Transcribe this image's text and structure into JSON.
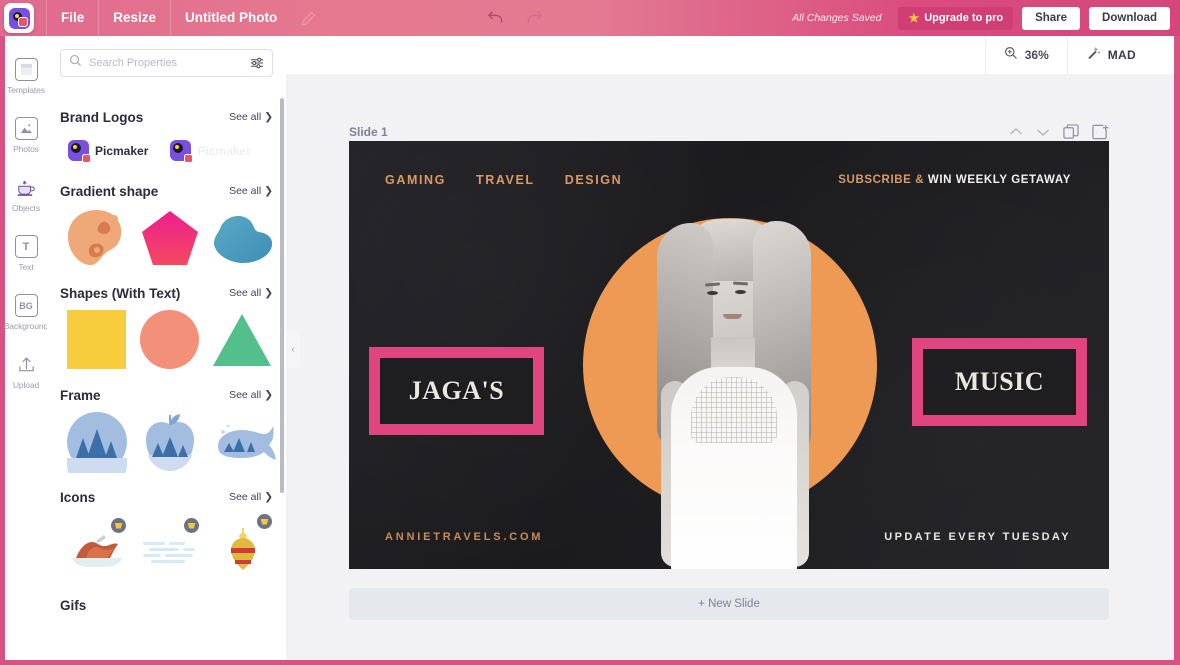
{
  "topbar": {
    "logo_icon": "picmaker-logo-icon",
    "menu": [
      {
        "label": "File"
      },
      {
        "label": "Resize"
      }
    ],
    "doc_title": "Untitled Photo",
    "edit_icon": "pencil-icon",
    "undo_icon": "undo-arrow-icon",
    "redo_icon": "redo-arrow-icon",
    "saved_status": "All Changes Saved",
    "upgrade_label": "Upgrade to pro",
    "upgrade_star": "★",
    "share_label": "Share",
    "download_label": "Download",
    "accent_pink": "#d4477c",
    "upgrade_bg": "#cf3f73"
  },
  "rail": {
    "items": [
      {
        "label": "Templates",
        "icon": "templates-icon",
        "glyph": "▤"
      },
      {
        "label": "Photos",
        "icon": "photos-image-icon",
        "glyph": "▣"
      },
      {
        "label": "Objects",
        "icon": "objects-cup-icon",
        "glyph": "☕"
      },
      {
        "label": "Text",
        "icon": "text-icon",
        "glyph": "T"
      },
      {
        "label": "Background",
        "icon": "background-icon",
        "glyph": "BG"
      },
      {
        "label": "Upload",
        "icon": "upload-arrow-icon",
        "glyph": "⭱"
      }
    ]
  },
  "panel": {
    "search": {
      "placeholder": "Search Properties",
      "value": "",
      "search_icon": "search-icon",
      "filter_icon": "filter-sliders-icon"
    },
    "see_all_label": "See all",
    "chevron": "❯",
    "collapse_icon": "chevron-left-icon",
    "sections": [
      {
        "title": "Brand Logos",
        "items": [
          {
            "name": "Picmaker",
            "faded": false
          },
          {
            "name": "Picmaker",
            "faded": true
          }
        ]
      },
      {
        "title": "Gradient shape",
        "items": [
          {
            "name": "blob-orange-shape"
          },
          {
            "name": "pentagon-pink-shape"
          },
          {
            "name": "blob-blue-shape"
          }
        ]
      },
      {
        "title": "Shapes (With Text)",
        "items": [
          {
            "name": "square-yellow-shape"
          },
          {
            "name": "circle-coral-shape"
          },
          {
            "name": "triangle-green-shape"
          }
        ]
      },
      {
        "title": "Frame",
        "items": [
          {
            "name": "circle-forest-frame"
          },
          {
            "name": "apple-forest-frame"
          },
          {
            "name": "whale-forest-frame"
          }
        ]
      },
      {
        "title": "Icons",
        "items": [
          {
            "name": "canoe-icon",
            "pro": true
          },
          {
            "name": "water-icon",
            "pro": true
          },
          {
            "name": "spinning-top-icon",
            "pro": true
          }
        ]
      },
      {
        "title": "Gifs",
        "items": []
      }
    ]
  },
  "stage": {
    "zoom_icon": "zoom-in-magnifier-icon",
    "zoom_level": "36%",
    "mad_icon": "magic-wand-icon",
    "mad_label": "MAD",
    "slide_label": "Slide 1",
    "tools": [
      {
        "name": "move-slide-up-icon",
        "glyph": "⌃"
      },
      {
        "name": "move-slide-down-icon",
        "glyph": "⌄"
      },
      {
        "name": "duplicate-slide-icon",
        "glyph": "❐"
      },
      {
        "name": "add-slide-icon",
        "glyph": "⊞"
      }
    ],
    "new_slide_label": "+ New Slide"
  },
  "canvas": {
    "background_color": "#1f1f22",
    "nav_links": [
      "GAMING",
      "TRAVEL",
      "DESIGN"
    ],
    "subscribe_prefix": "SUBSCRIBE &",
    "subscribe_suffix": "WIN WEEKLY GETAWAY",
    "frames": [
      {
        "name": "jagas-frame",
        "text": "JAGA'S",
        "border_color": "#e0457f"
      },
      {
        "name": "music-frame",
        "text": "MUSIC",
        "border_color": "#e0457f"
      }
    ],
    "circle_color": "#ee9a55",
    "portrait": "woman-portrait-photo",
    "site_url": "ANNIETRAVELS.COM",
    "update_text": "UPDATE EVERY TUESDAY",
    "accent_orange": "#d99a66"
  }
}
